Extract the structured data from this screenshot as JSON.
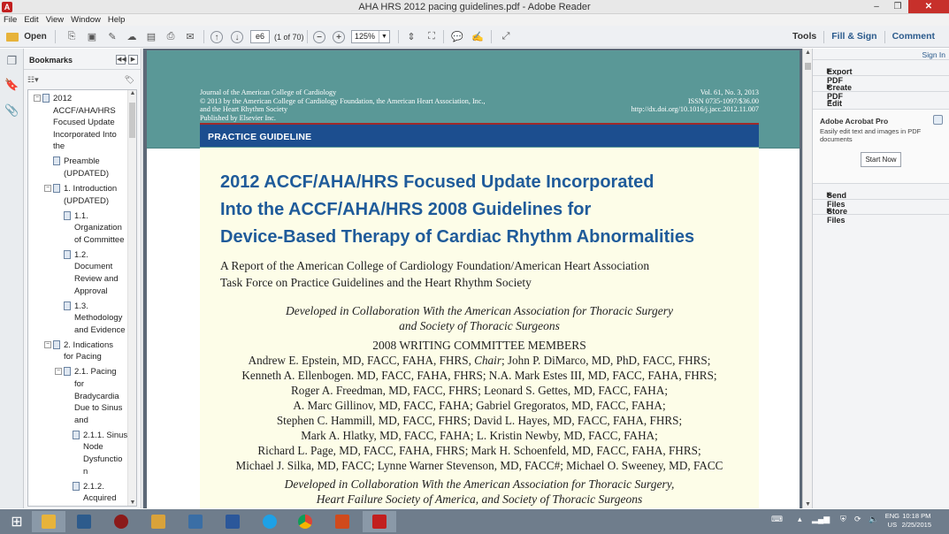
{
  "window": {
    "title": "AHA HRS 2012 pacing guidelines.pdf - Adobe Reader",
    "min": "–",
    "max": "❐",
    "close": "✕"
  },
  "menu": [
    "File",
    "Edit",
    "View",
    "Window",
    "Help"
  ],
  "toolbar": {
    "open_label": "Open",
    "page_value": "e6",
    "page_of": "(1 of 70)",
    "zoom_value": "125%",
    "tools_label": "Tools",
    "fill_sign_label": "Fill & Sign",
    "comment_label": "Comment"
  },
  "bookmarks": {
    "title": "Bookmarks",
    "items": [
      {
        "level": 0,
        "exp": "⊟",
        "lines": [
          "2012",
          "ACCF/AHA/HRS",
          "Focused Update",
          "Incorporated Into",
          "the"
        ]
      },
      {
        "level": 1,
        "exp": "",
        "lines": [
          "Preamble",
          "(UPDATED)"
        ]
      },
      {
        "level": 1,
        "exp": "⊟",
        "lines": [
          "1. Introduction",
          "(UPDATED)"
        ]
      },
      {
        "level": 2,
        "exp": "",
        "lines": [
          "1.1.",
          "Organization",
          "of Committee"
        ]
      },
      {
        "level": 2,
        "exp": "",
        "lines": [
          "1.2.",
          "Document",
          "Review and",
          "Approval"
        ]
      },
      {
        "level": 2,
        "exp": "",
        "lines": [
          "1.3.",
          "Methodology",
          "and Evidence"
        ]
      },
      {
        "level": 1,
        "exp": "⊟",
        "lines": [
          "2. Indications",
          "for Pacing"
        ]
      },
      {
        "level": 2,
        "exp": "⊟",
        "lines": [
          "2.1. Pacing",
          "for",
          "Bradycardia",
          "Due to Sinus",
          "and"
        ]
      },
      {
        "level": 3,
        "exp": "",
        "lines": [
          "2.1.1. Sinus",
          "Node",
          "Dysfunctio",
          "n"
        ]
      },
      {
        "level": 3,
        "exp": "",
        "lines": [
          "2.1.2.",
          "Acquired"
        ]
      }
    ]
  },
  "document": {
    "journal_left": [
      "Journal of the American College of Cardiology",
      "© 2013 by the American College of Cardiology Foundation, the American Heart Association, Inc.,",
      "and the Heart Rhythm Society",
      "Published by Elsevier Inc."
    ],
    "journal_right": [
      "Vol. 61, No. 3, 2013",
      "ISSN 0735-1097/$36.00",
      "http://dx.doi.org/10.1016/j.jacc.2012.11.007"
    ],
    "section_banner": "PRACTICE GUIDELINE",
    "title_lines": [
      "2012 ACCF/AHA/HRS Focused Update Incorporated",
      "Into the ACCF/AHA/HRS 2008 Guidelines for",
      "Device-Based Therapy of Cardiac Rhythm Abnormalities"
    ],
    "subtitle_lines": [
      "A Report of the American College of Cardiology Foundation/American Heart Association",
      "Task Force on Practice Guidelines and the Heart Rhythm Society"
    ],
    "collab1_lines": [
      "Developed in Collaboration With the American Association for Thoracic Surgery",
      "and Society of Thoracic Surgeons"
    ],
    "committee_heading": "2008 WRITING COMMITTEE MEMBERS",
    "authors": [
      "Andrew E. Epstein, MD, FACC, FAHA, FHRS, Chair; John P. DiMarco, MD, PhD, FACC, FHRS;",
      "Kenneth A. Ellenbogen. MD, FACC, FAHA, FHRS; N.A. Mark Estes III, MD, FACC, FAHA, FHRS;",
      "Roger A. Freedman, MD, FACC, FHRS; Leonard S. Gettes, MD, FACC, FAHA;",
      "A. Marc Gillinov, MD, FACC, FAHA; Gabriel Gregoratos, MD, FACC, FAHA;",
      "Stephen C. Hammill, MD, FACC, FHRS; David L. Hayes, MD, FACC, FAHA, FHRS;",
      "Mark A. Hlatky, MD, FACC, FAHA; L. Kristin Newby, MD, FACC, FAHA;",
      "Richard L. Page, MD, FACC, FAHA, FHRS; Mark H. Schoenfeld, MD, FACC, FAHA, FHRS;",
      "Michael J. Silka, MD, FACC; Lynne Warner Stevenson, MD, FACC#; Michael O. Sweeney, MD, FACC"
    ],
    "collab2_lines": [
      "Developed in Collaboration With the American Association for Thoracic Surgery,",
      "Heart Failure Society of America, and Society of Thoracic Surgeons"
    ]
  },
  "right_panel": {
    "sign_in": "Sign In",
    "export_pdf": "Export PDF",
    "create_pdf": "Create PDF",
    "edit_pdf": "Edit PDF",
    "acrobat_title": "Adobe Acrobat Pro",
    "acrobat_desc": "Easily edit text and images in PDF documents",
    "start_now": "Start Now",
    "send_files": "Send Files",
    "store_files": "Store Files"
  },
  "taskbar": {
    "lang_top": "ENG",
    "lang_bottom": "US",
    "time": "10:18 PM",
    "date": "2/25/2015"
  },
  "colors": {
    "teal_header": "#5a9897",
    "banner_blue": "#1c4e8f",
    "title_blue": "#1f5b9a",
    "cream_page": "#fdfde8"
  }
}
